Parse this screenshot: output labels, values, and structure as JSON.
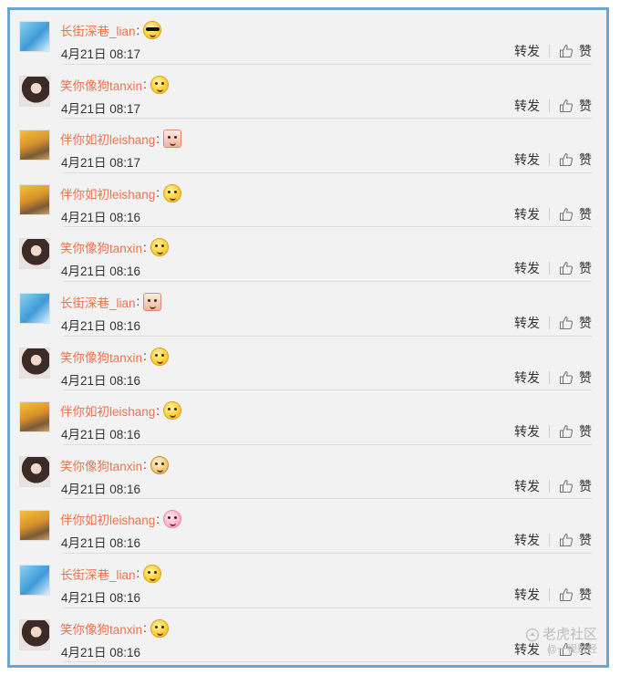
{
  "actions": {
    "repost_label": "转发",
    "like_label": "赞"
  },
  "comments": [
    {
      "user": "长街深巷_lian",
      "avatar": "blue",
      "emoji": "sunglasses-emoji",
      "time": "4月21日 08:17"
    },
    {
      "user": "笑你像狗tanxin",
      "avatar": "dark",
      "emoji": "laughing-emoji",
      "time": "4月21日 08:17"
    },
    {
      "user": "伴你如初leishang",
      "avatar": "gold",
      "emoji": "sticker-emoji",
      "time": "4月21日 08:17"
    },
    {
      "user": "伴你如初leishang",
      "avatar": "gold",
      "emoji": "giggle-emoji",
      "time": "4月21日 08:16"
    },
    {
      "user": "笑你像狗tanxin",
      "avatar": "dark",
      "emoji": "heart-eyes-emoji",
      "time": "4月21日 08:16"
    },
    {
      "user": "长街深巷_lian",
      "avatar": "blue",
      "emoji": "sticker-emoji",
      "time": "4月21日 08:16"
    },
    {
      "user": "笑你像狗tanxin",
      "avatar": "dark",
      "emoji": "thinking-emoji",
      "time": "4月21日 08:16"
    },
    {
      "user": "伴你如初leishang",
      "avatar": "gold",
      "emoji": "glasses-emoji",
      "time": "4月21日 08:16"
    },
    {
      "user": "笑你像狗tanxin",
      "avatar": "dark",
      "emoji": "doge-emoji",
      "time": "4月21日 08:16"
    },
    {
      "user": "伴你如初leishang",
      "avatar": "gold",
      "emoji": "pig-emoji",
      "time": "4月21日 08:16"
    },
    {
      "user": "长街深巷_lian",
      "avatar": "blue",
      "emoji": "hehe-emoji",
      "time": "4月21日 08:16"
    },
    {
      "user": "笑你像狗tanxin",
      "avatar": "dark",
      "emoji": "grin-emoji",
      "time": "4月21日 08:16"
    }
  ],
  "watermark": {
    "line1": "老虎社区",
    "line2": "@一视财经"
  },
  "colors": {
    "username": "#eb7350",
    "frame": "#6aa6cf",
    "background": "#f2f2f2"
  }
}
